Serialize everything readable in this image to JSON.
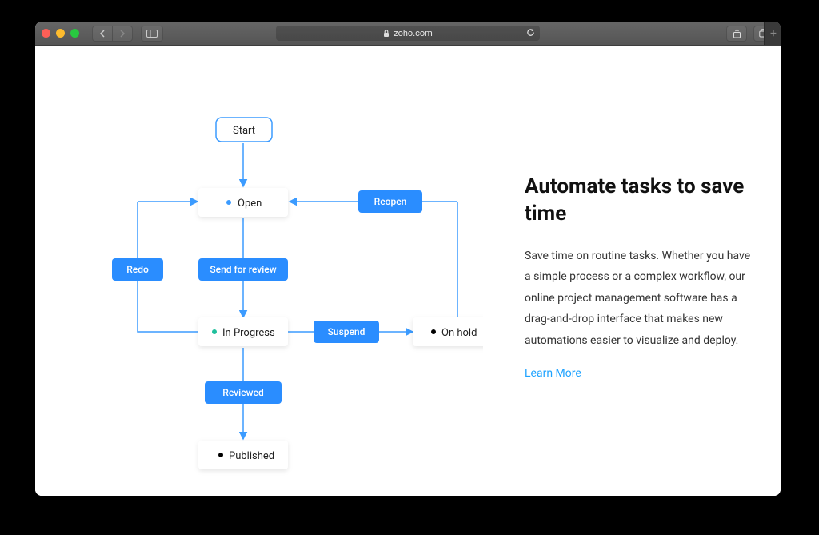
{
  "browser": {
    "address": "zoho.com",
    "lock": true
  },
  "diagram": {
    "states": {
      "start": "Start",
      "open": "Open",
      "in_progress": "In Progress",
      "on_hold": "On hold",
      "published": "Published"
    },
    "transitions": {
      "reopen": "Reopen",
      "redo": "Redo",
      "send_for_review": "Send for review",
      "suspend": "Suspend",
      "reviewed": "Reviewed"
    }
  },
  "copy": {
    "heading": "Automate tasks to save time",
    "body": "Save time on routine tasks. Whether you have a simple process or a complex workflow, our online project management software has a drag-and-drop interface that makes new automations easier to visualize and deploy.",
    "cta": "Learn More"
  }
}
